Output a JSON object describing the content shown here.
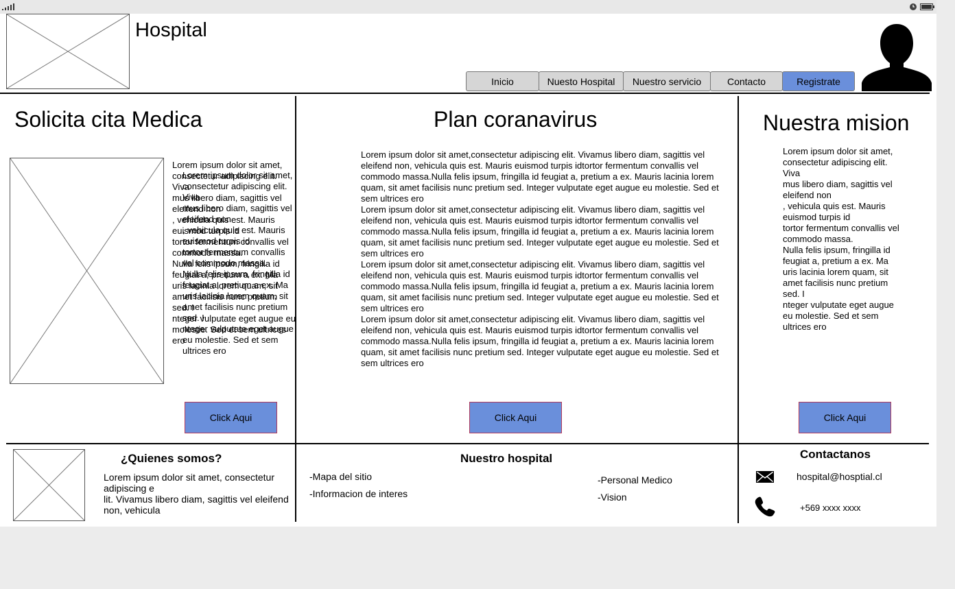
{
  "header": {
    "title": "Hospital",
    "nav": [
      {
        "label": "Inicio"
      },
      {
        "label": "Nuesto Hospital"
      },
      {
        "label": "Nuestro servicio"
      },
      {
        "label": "Contacto"
      },
      {
        "label": "Registrate"
      }
    ]
  },
  "columns": {
    "cita": {
      "title": "Solicita cita Medica",
      "text_a": "Lorem ipsum dolor sit amet,\nconsectetur adipiscing elit. Viva\nmus libero diam, sagittis vel eleifend non\n, vehicula quis est. Mauris euismod turpis id\ntortor fermentum convallis vel commodo massa.\nNulla felis ipsum, fringilla id feugiat a, pretium a ex. Ma\nuris lacinia lorem quam, sit amet facilisis nunc pretium sed. I\nnteger vulputate eget augue eu molestie. Sed et sem ultrices ero",
      "text_b": "Lorem ipsum dolor sit amet,\nconsectetur adipiscing elit. Viva\nmus libero diam, sagittis vel eleifend non\n, vehicula quis est. Mauris euismod turpis id\ntortor fermentum convallis vel commodo massa.\nNulla felis ipsum, fringilla id feugiat a, pretium a ex. Ma\nuris lacinia lorem quam, sit amet facilisis nunc pretium sed. I\nnteger vulputate eget augue eu molestie. Sed et sem ultrices ero",
      "button": "Click Aqui"
    },
    "plan": {
      "title": "Plan coranavirus",
      "paragraph": "Lorem ipsum dolor sit amet,consectetur adipiscing elit. Vivamus libero diam, sagittis vel eleifend non, vehicula quis est. Mauris euismod turpis idtortor fermentum convallis vel commodo massa.Nulla felis ipsum, fringilla id feugiat a, pretium a ex. Mauris lacinia lorem quam, sit amet facilisis nunc pretium sed. Integer vulputate eget augue eu molestie. Sed et sem ultrices ero",
      "button": "Click Aqui"
    },
    "mision": {
      "title": "Nuestra mision",
      "text": "Lorem ipsum dolor sit amet,\nconsectetur adipiscing elit. Viva\nmus libero diam, sagittis vel eleifend non\n, vehicula quis est. Mauris euismod turpis id\ntortor fermentum convallis vel commodo massa.\nNulla felis ipsum, fringilla id feugiat a, pretium a ex. Ma\nuris lacinia lorem quam, sit amet facilisis nunc pretium sed. I\nnteger vulputate eget augue eu molestie. Sed et sem ultrices ero",
      "button": "Click Aqui"
    }
  },
  "footer": {
    "about": {
      "title": "¿Quienes somos?",
      "text": "Lorem ipsum dolor sit amet, consectetur adipiscing e\nlit. Vivamus libero diam, sagittis vel eleifend non, vehicula"
    },
    "hospital": {
      "title": "Nuestro hospital",
      "links": [
        "-Mapa del sitio",
        "-Informacion de interes",
        "-Personal Medico",
        "-Vision"
      ]
    },
    "contact": {
      "title": "Contactanos",
      "email": "hospital@hosptial.cl",
      "phone": "+569 xxxx xxxx"
    }
  },
  "icons": {
    "signal": "signal-icon",
    "battery": "battery-icon",
    "mail": "mail-icon",
    "phone": "phone-icon",
    "user": "user-avatar-icon"
  },
  "colors": {
    "accent": "#6a8fdb",
    "nav_button": "#d6d6d6",
    "cta_border": "#b33a5a"
  }
}
